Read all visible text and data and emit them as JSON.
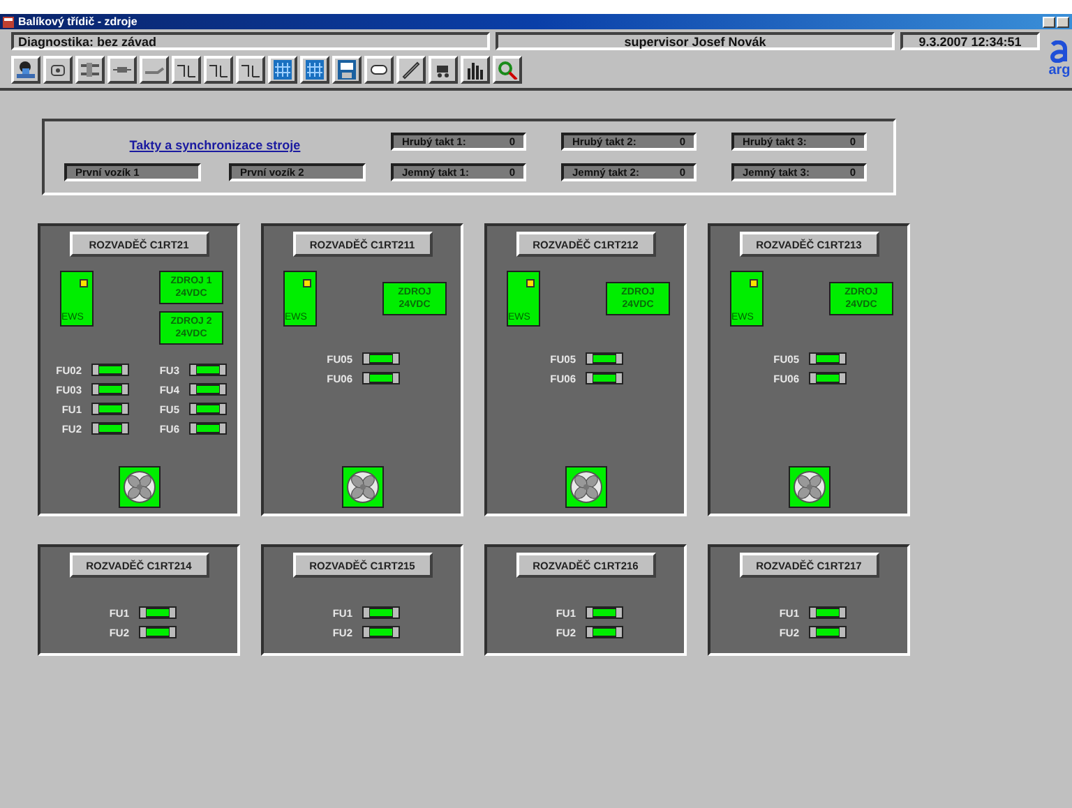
{
  "window": {
    "title": "Balíkový třídič - zdroje"
  },
  "status_bar": {
    "diagnostics": "Diagnostika: bez závad",
    "user": "supervisor Josef Novák",
    "datetime": "9.3.2007  12:34:51"
  },
  "logo": {
    "text": "arg"
  },
  "sync_panel": {
    "link": "Takty a synchronizace stroje",
    "carts": [
      "První vozík 1",
      "První vozík 2"
    ],
    "takts": [
      {
        "label": "Hrubý takt 1:",
        "value": "0"
      },
      {
        "label": "Hrubý takt 2:",
        "value": "0"
      },
      {
        "label": "Hrubý takt 3:",
        "value": "0"
      },
      {
        "label": "Jemný takt 1:",
        "value": "0"
      },
      {
        "label": "Jemný takt 2:",
        "value": "0"
      },
      {
        "label": "Jemný takt 3:",
        "value": "0"
      }
    ]
  },
  "cabinets": [
    {
      "title": "ROZVADĚČ C1RT21",
      "ews": {
        "label": "EWS",
        "led": true
      },
      "supplies": [
        {
          "lines": [
            "ZDROJ 1",
            "24VDC"
          ]
        },
        {
          "lines": [
            "ZDROJ 2",
            "24VDC"
          ]
        }
      ],
      "fuse_columns": [
        [
          {
            "label": "FU02",
            "ok": true
          },
          {
            "label": "FU03",
            "ok": true
          },
          {
            "label": "FU1",
            "ok": true
          },
          {
            "label": "FU2",
            "ok": true
          }
        ],
        [
          {
            "label": "FU3",
            "ok": true
          },
          {
            "label": "FU4",
            "ok": true
          },
          {
            "label": "FU5",
            "ok": true
          },
          {
            "label": "FU6",
            "ok": true
          }
        ]
      ],
      "fan": true
    },
    {
      "title": "ROZVADĚČ C1RT211",
      "ews": {
        "label": "EWS",
        "led": true
      },
      "supplies": [
        {
          "lines": [
            "ZDROJ",
            "24VDC"
          ]
        }
      ],
      "fuse_columns": [
        [
          {
            "label": "FU05",
            "ok": true
          },
          {
            "label": "FU06",
            "ok": true
          }
        ]
      ],
      "fan": true
    },
    {
      "title": "ROZVADĚČ C1RT212",
      "ews": {
        "label": "EWS",
        "led": true
      },
      "supplies": [
        {
          "lines": [
            "ZDROJ",
            "24VDC"
          ]
        }
      ],
      "fuse_columns": [
        [
          {
            "label": "FU05",
            "ok": true
          },
          {
            "label": "FU06",
            "ok": true
          }
        ]
      ],
      "fan": true
    },
    {
      "title": "ROZVADĚČ C1RT213",
      "ews": {
        "label": "EWS",
        "led": true
      },
      "supplies": [
        {
          "lines": [
            "ZDROJ",
            "24VDC"
          ]
        }
      ],
      "fuse_columns": [
        [
          {
            "label": "FU05",
            "ok": true
          },
          {
            "label": "FU06",
            "ok": true
          }
        ]
      ],
      "fan": true
    },
    {
      "title": "ROZVADĚČ C1RT214",
      "fuse_columns": [
        [
          {
            "label": "FU1",
            "ok": true
          },
          {
            "label": "FU2",
            "ok": true
          }
        ]
      ],
      "fan": false
    },
    {
      "title": "ROZVADĚČ C1RT215",
      "fuse_columns": [
        [
          {
            "label": "FU1",
            "ok": true
          },
          {
            "label": "FU2",
            "ok": true
          }
        ]
      ],
      "fan": false
    },
    {
      "title": "ROZVADĚČ C1RT216",
      "fuse_columns": [
        [
          {
            "label": "FU1",
            "ok": true
          },
          {
            "label": "FU2",
            "ok": true
          }
        ]
      ],
      "fan": false
    },
    {
      "title": "ROZVADĚČ C1RT217",
      "fuse_columns": [
        [
          {
            "label": "FU1",
            "ok": true
          },
          {
            "label": "FU2",
            "ok": true
          }
        ]
      ],
      "fan": false
    }
  ]
}
